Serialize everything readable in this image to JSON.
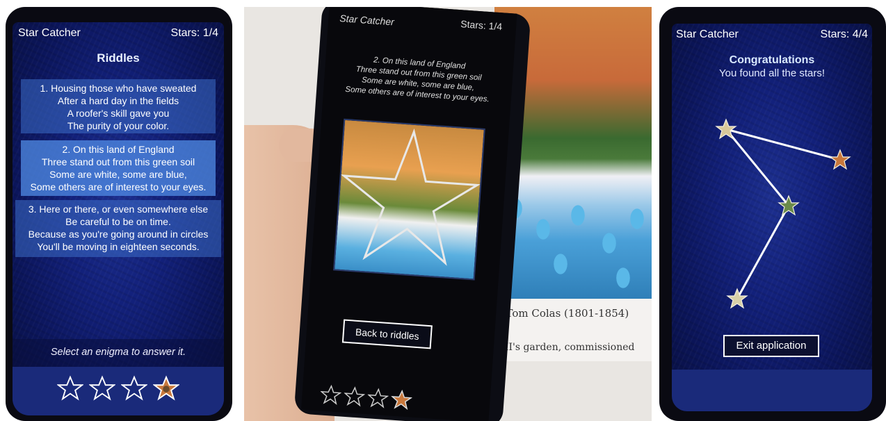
{
  "app": {
    "name": "Star Catcher"
  },
  "screen1": {
    "stars_text": "Stars: 1/4",
    "title": "Riddles",
    "riddles": [
      {
        "lines": [
          "1. Housing those who have sweated",
          "After a hard day in the fields",
          "A roofer's skill gave you",
          "The purity of your color."
        ]
      },
      {
        "lines": [
          "2. On this land of England",
          "Three stand out from this green soil",
          "Some are white, some are blue,",
          "Some others are of interest to your eyes."
        ]
      },
      {
        "lines": [
          "3. Here or there, or even somewhere else",
          "Be careful to be on time.",
          "Because as you're going around in circles",
          "You'll be moving in eighteen seconds."
        ]
      }
    ],
    "hint": "Select an enigma to answer it.",
    "star_slots": [
      "empty-star-icon",
      "empty-star-icon",
      "empty-star-icon",
      "found-star-icon"
    ]
  },
  "screen2": {
    "stars_text": "Stars: 1/4",
    "riddle_lines": [
      "2. On this land of England",
      "Three stand out from this green soil",
      "Some are white, some are blue,",
      "Some others are of interest to your eyes."
    ],
    "back_button": "Back to riddles",
    "caption_line1": "Tom Colas (1801-1854)",
    "caption_line2": "es II's garden, commissioned",
    "caption_prefix": "I.",
    "star_slots": [
      "empty-star-icon",
      "empty-star-icon",
      "empty-star-icon",
      "found-star-icon"
    ]
  },
  "screen3": {
    "stars_text": "Stars: 4/4",
    "congrats_title": "Congratulations",
    "congrats_sub": "You found all the stars!",
    "exit_button": "Exit application",
    "constellation_icons": [
      "star-icon",
      "star-icon",
      "star-icon",
      "star-icon"
    ]
  },
  "colors": {
    "background_deep": "#0b155a",
    "panel_blue": "#3c6ec8",
    "found_star_orange": "#c8783c",
    "text_white": "#ffffff"
  }
}
